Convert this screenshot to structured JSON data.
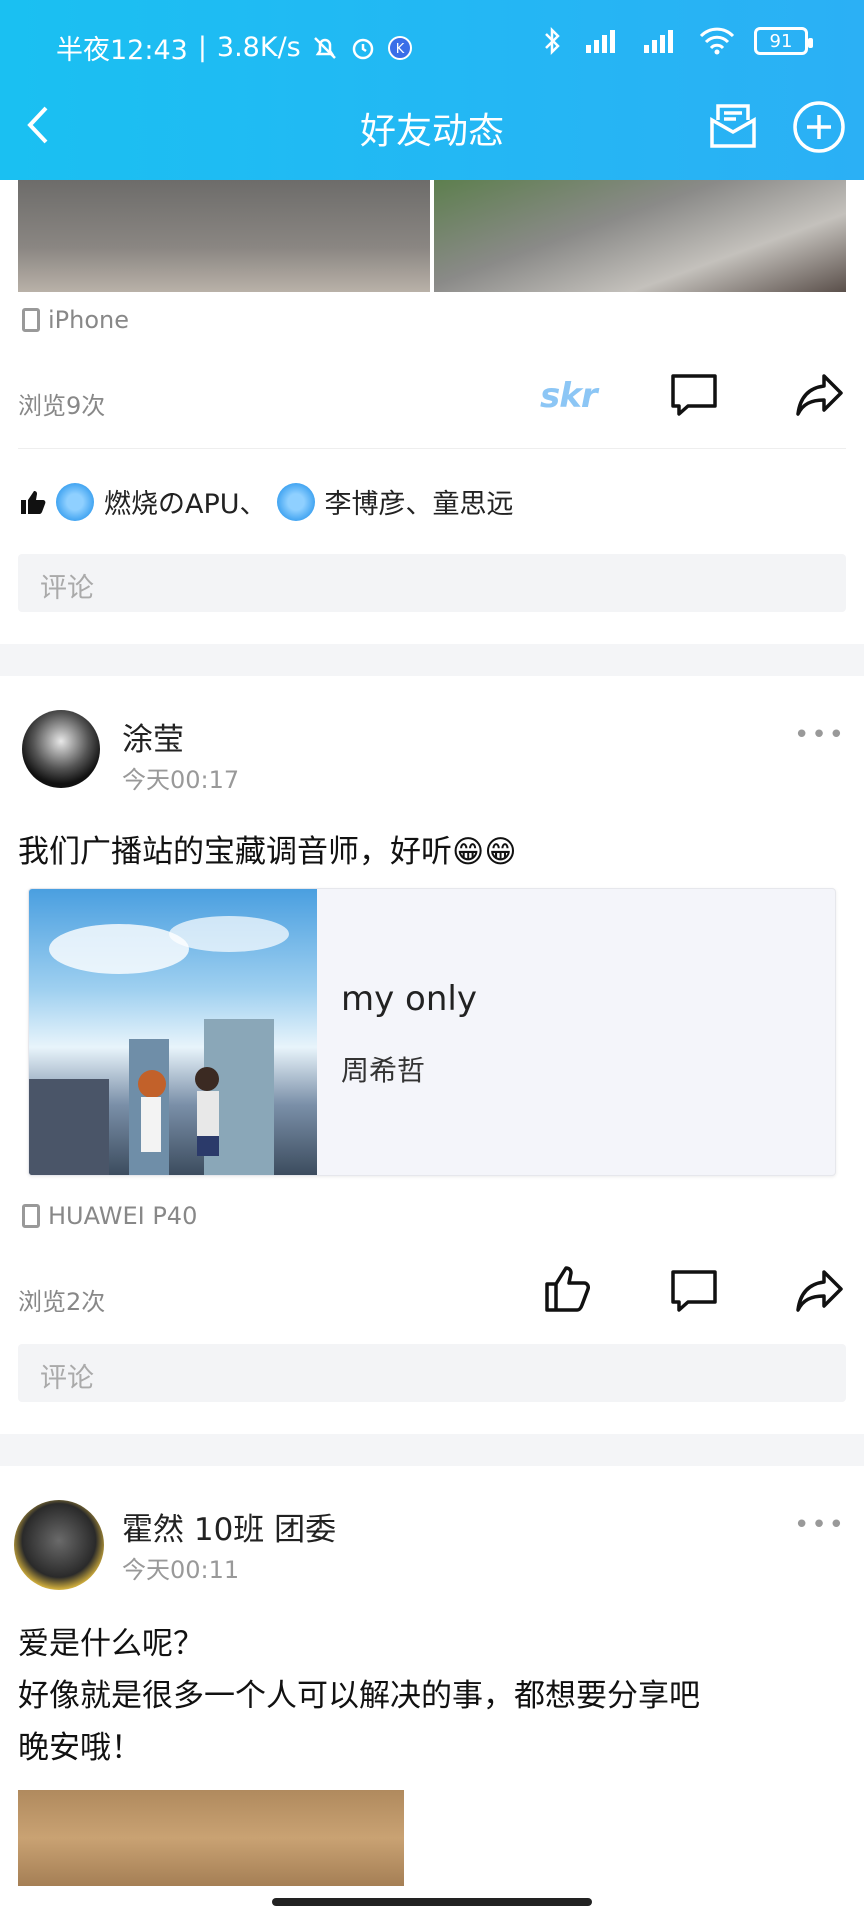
{
  "status_bar": {
    "time": "半夜12:43",
    "speed": "3.8K/s",
    "battery": "91"
  },
  "header": {
    "title": "好友动态"
  },
  "post1": {
    "device": "iPhone",
    "views": "浏览9次",
    "reaction_label": "skr",
    "likes_user1": "燃烧のAPU、",
    "likes_user2": "李博彦、童思远",
    "comment_placeholder": "评论"
  },
  "post2": {
    "user": "涂莹",
    "time": "今天00:17",
    "text": "我们广播站的宝藏调音师，好听😁😁",
    "music": {
      "title": "my only",
      "artist": "周希哲"
    },
    "device": "HUAWEI P40",
    "views": "浏览2次",
    "comment_placeholder": "评论"
  },
  "post3": {
    "user": "霍然 10班 团委",
    "time": "今天00:11",
    "text_line1": "爱是什么呢？",
    "text_line2": "好像就是很多一个人可以解决的事，都想要分享吧",
    "text_line3": "晚安哦！"
  },
  "more_symbol": "•••"
}
